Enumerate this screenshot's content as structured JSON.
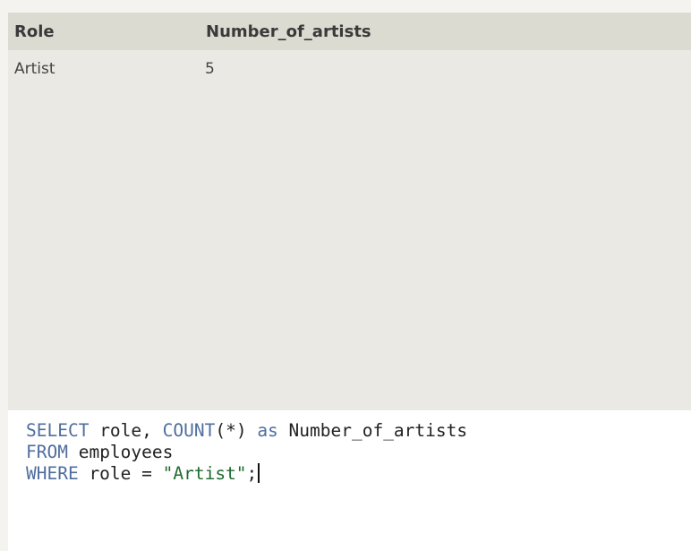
{
  "results": {
    "columns": [
      "Role",
      "Number_of_artists"
    ],
    "rows": [
      [
        "Artist",
        "5"
      ]
    ]
  },
  "editor": {
    "line1": {
      "kw_select": "SELECT",
      "t_role": " role, ",
      "kw_count": "COUNT",
      "t_star": "(*) ",
      "kw_as": "as",
      "t_alias": " Number_of_artists"
    },
    "line2": {
      "kw_from": "FROM",
      "t_table": " employees"
    },
    "line3": {
      "kw_where": "WHERE",
      "t_cond": " role = ",
      "str_val": "\"Artist\"",
      "t_end": ";"
    }
  },
  "colors": {
    "keyword": "#4f6e9f",
    "string": "#1f6b2e",
    "header_bg": "#dcdbd1",
    "results_bg": "#eae9e3",
    "editor_bg": "#ffffff"
  }
}
